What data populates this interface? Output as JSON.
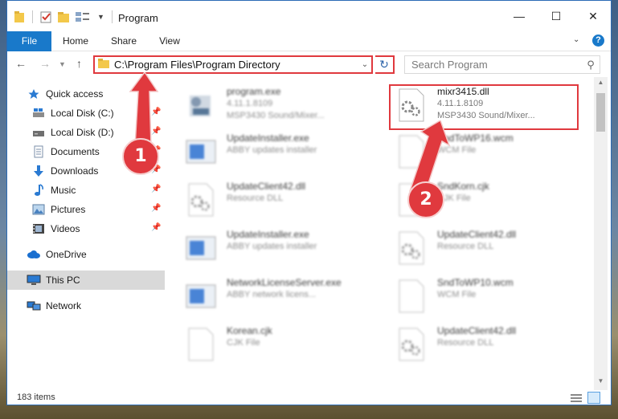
{
  "window": {
    "title": "Program",
    "min_glyph": "—",
    "max_glyph": "☐",
    "close_glyph": "✕"
  },
  "ribbon": {
    "tabs": [
      {
        "label": "File",
        "active": true
      },
      {
        "label": "Home"
      },
      {
        "label": "Share"
      },
      {
        "label": "View"
      }
    ],
    "help_glyph": "?"
  },
  "nav": {
    "address": "C:\\Program Files\\Program Directory",
    "search_placeholder": "Search Program"
  },
  "sidebar": {
    "items": [
      {
        "label": "Quick access",
        "icon": "star-icon",
        "pinned": false
      },
      {
        "label": "Local Disk (C:)",
        "icon": "drive-c-icon",
        "pinned": true
      },
      {
        "label": "Local Disk (D:)",
        "icon": "drive-icon",
        "pinned": true
      },
      {
        "label": "Documents",
        "icon": "documents-icon",
        "pinned": true
      },
      {
        "label": "Downloads",
        "icon": "downloads-icon",
        "pinned": true
      },
      {
        "label": "Music",
        "icon": "music-icon",
        "pinned": true
      },
      {
        "label": "Pictures",
        "icon": "pictures-icon",
        "pinned": true
      },
      {
        "label": "Videos",
        "icon": "videos-icon",
        "pinned": true
      },
      {
        "label": "OneDrive",
        "icon": "onedrive-icon",
        "pinned": false
      },
      {
        "label": "This PC",
        "icon": "this-pc-icon",
        "pinned": false,
        "selected": true
      },
      {
        "label": "Network",
        "icon": "network-icon",
        "pinned": false
      }
    ]
  },
  "files": [
    {
      "name": "program.exe",
      "line2": "4.11.1.8109",
      "line3": "MSP3430 Sound/Mixer...",
      "icon": "exe-icon",
      "blurred": true
    },
    {
      "name": "mixr3415.dll",
      "line2": "4.11.1.8109",
      "line3": "MSP3430 Sound/Mixer...",
      "icon": "dll-gear-icon",
      "blurred": false,
      "highlighted": true
    },
    {
      "name": "UpdateInstaller.exe",
      "line2": "ABBY updates installer",
      "line3": "",
      "icon": "installer-icon",
      "blurred": true
    },
    {
      "name": "SndToWP16.wcm",
      "line2": "WCM File",
      "line3": "",
      "icon": "blank-file-icon",
      "blurred": true
    },
    {
      "name": "UpdateClient42.dll",
      "line2": "Resource DLL",
      "line3": "",
      "icon": "dll-gear-icon",
      "blurred": true
    },
    {
      "name": "SndKorn.cjk",
      "line2": "CJK File",
      "line3": "",
      "icon": "blank-file-icon",
      "blurred": true
    },
    {
      "name": "UpdateInstaller.exe",
      "line2": "ABBY updates installer",
      "line3": "",
      "icon": "installer-icon",
      "blurred": true
    },
    {
      "name": "UpdateClient42.dll",
      "line2": "Resource DLL",
      "line3": "",
      "icon": "dll-gear-icon",
      "blurred": true
    },
    {
      "name": "NetworkLicenseServer.exe",
      "line2": "ABBY network licens...",
      "line3": "",
      "icon": "installer-icon",
      "blurred": true
    },
    {
      "name": "SndToWP10.wcm",
      "line2": "WCM File",
      "line3": "",
      "icon": "blank-file-icon",
      "blurred": true
    },
    {
      "name": "Korean.cjk",
      "line2": "CJK File",
      "line3": "",
      "icon": "blank-file-icon",
      "blurred": true
    },
    {
      "name": "UpdateClient42.dll",
      "line2": "Resource DLL",
      "line3": "",
      "icon": "dll-gear-icon",
      "blurred": true
    }
  ],
  "status": {
    "count": "183 items"
  },
  "annotations": {
    "step1": "1",
    "step2": "2"
  },
  "colors": {
    "accent": "#1979ca",
    "annotation_red": "#e0393e",
    "selection": "#cce8ff"
  }
}
